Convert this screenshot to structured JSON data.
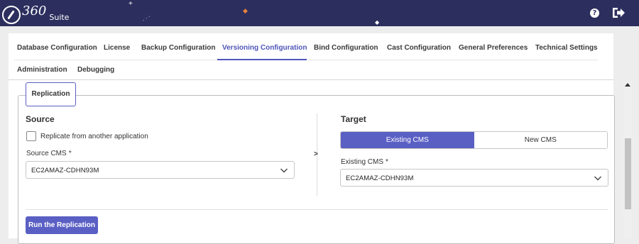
{
  "app": {
    "logo_num": "360",
    "logo_suite": "Suite"
  },
  "header": {
    "help_icon": "question-circle-icon",
    "help_glyph": "?",
    "logout_icon": "logout-icon"
  },
  "tabs": [
    {
      "label": "Database Configuration",
      "active": false
    },
    {
      "label": "License",
      "active": false
    },
    {
      "label": "Backup Configuration",
      "active": false
    },
    {
      "label": "Versioning Configuration",
      "active": true
    },
    {
      "label": "Bind Configuration",
      "active": false
    },
    {
      "label": "Cast Configuration",
      "active": false
    },
    {
      "label": "General Preferences",
      "active": false
    },
    {
      "label": "Technical Settings",
      "active": false
    },
    {
      "label": "Administration",
      "active": false
    },
    {
      "label": "Debugging",
      "active": false
    }
  ],
  "replication": {
    "tab_label": "Replication",
    "source": {
      "heading": "Source",
      "checkbox_label": "Replicate from another application",
      "checkbox_checked": false,
      "cms_label": "Source CMS",
      "required_mark": "*",
      "cms_value": "EC2AMAZ-CDHN93M"
    },
    "arrow": ">",
    "target": {
      "heading": "Target",
      "options": [
        "Existing CMS",
        "New CMS"
      ],
      "selected_option": "Existing CMS",
      "cms_label": "Existing CMS",
      "required_mark": "*",
      "cms_value": "EC2AMAZ-CDHN93M"
    },
    "run_button": "Run the Replication"
  },
  "colors": {
    "header_bg": "#2c2f5e",
    "accent": "#5a5fc4",
    "active_tab": "#4f55b8"
  }
}
